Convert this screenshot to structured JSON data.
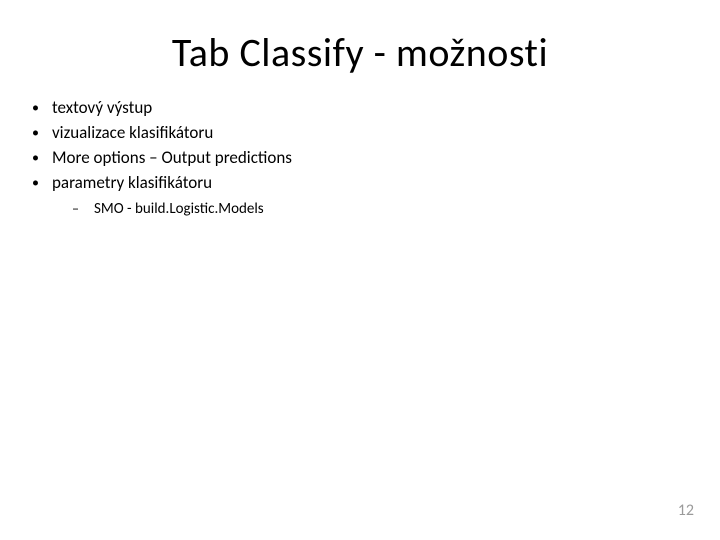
{
  "title": "Tab Classify - možnosti",
  "bullets": {
    "items": [
      {
        "text": "textový výstup"
      },
      {
        "text": "vizualizace klasifikátoru"
      },
      {
        "text": "More options – Output predictions"
      },
      {
        "text": "parametry klasifikátoru"
      }
    ],
    "marker": "•",
    "subitems": [
      {
        "text": "SMO - build.Logistic.Models"
      }
    ],
    "submarker": "–"
  },
  "pageNumber": "12"
}
